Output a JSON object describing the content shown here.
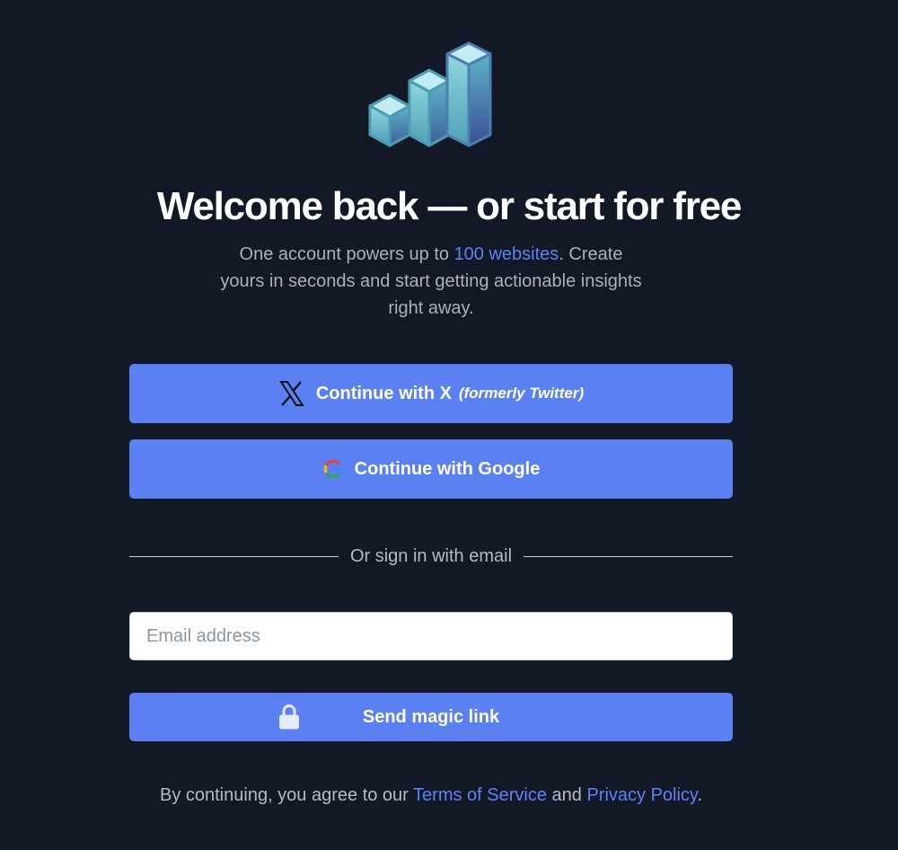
{
  "logo": {
    "icon": "bar-chart-cubes-icon"
  },
  "header": {
    "title": "Welcome back — or start for free",
    "subtitle_before": "One account powers up to ",
    "subtitle_highlight": "100 websites",
    "subtitle_after": ". Create yours in seconds and start getting actionable insights right away."
  },
  "oauth": {
    "x_label": "Continue with X",
    "x_note": "(formerly Twitter)",
    "x_icon": "x-logo-icon",
    "google_label": "Continue with Google",
    "google_icon": "google-logo-icon"
  },
  "divider": {
    "label": "Or sign in with email"
  },
  "email": {
    "placeholder": "Email address",
    "value": ""
  },
  "magic_link": {
    "label": "Send magic link",
    "icon": "lock-icon"
  },
  "legal": {
    "prefix": "By continuing, you agree to our ",
    "terms": "Terms of Service",
    "middle": " and ",
    "privacy": "Privacy Policy",
    "suffix": "."
  },
  "colors": {
    "background": "#131826",
    "accent": "#5a80f2",
    "link": "#5b84f5",
    "muted_text": "#a9b0bf"
  }
}
